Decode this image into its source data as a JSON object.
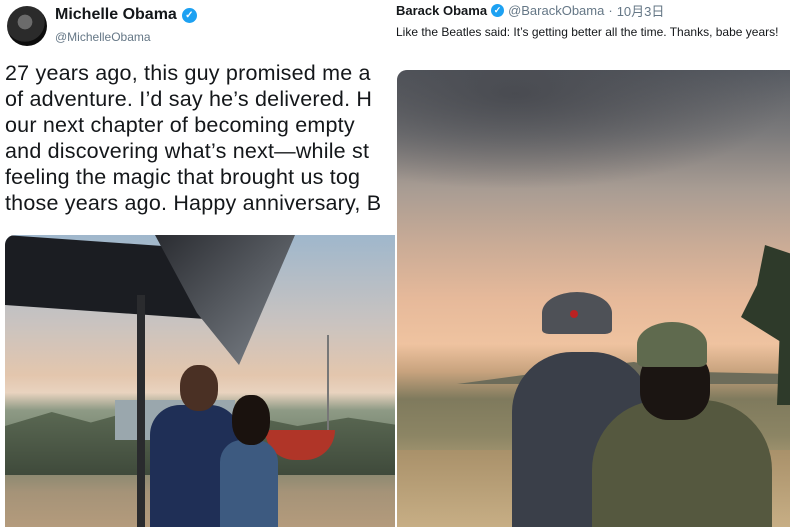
{
  "left_tweet": {
    "author_name": "Michelle Obama",
    "verified_mark": "✓",
    "handle": "@MichelleObama",
    "text_lines": [
      "27 years ago, this guy promised me a",
      "of adventure. I’d say he’s delivered. H",
      "our next chapter of becoming empty",
      "and discovering what’s next—while st",
      "feeling the magic that brought us tog",
      "those years ago. Happy anniversary, B"
    ],
    "photo_icon": "photo-couple-porch"
  },
  "right_tweet": {
    "author_name": "Barack Obama",
    "verified_mark": "✓",
    "handle": "@BarackObama",
    "separator": "·",
    "date": "10月3日",
    "text": "Like the Beatles said: It’s getting better all the time. Thanks, babe years!",
    "photo_icon": "photo-couple-sunset"
  },
  "colors": {
    "verified": "#1da1f2",
    "text": "#14171a",
    "secondary": "#657786"
  }
}
